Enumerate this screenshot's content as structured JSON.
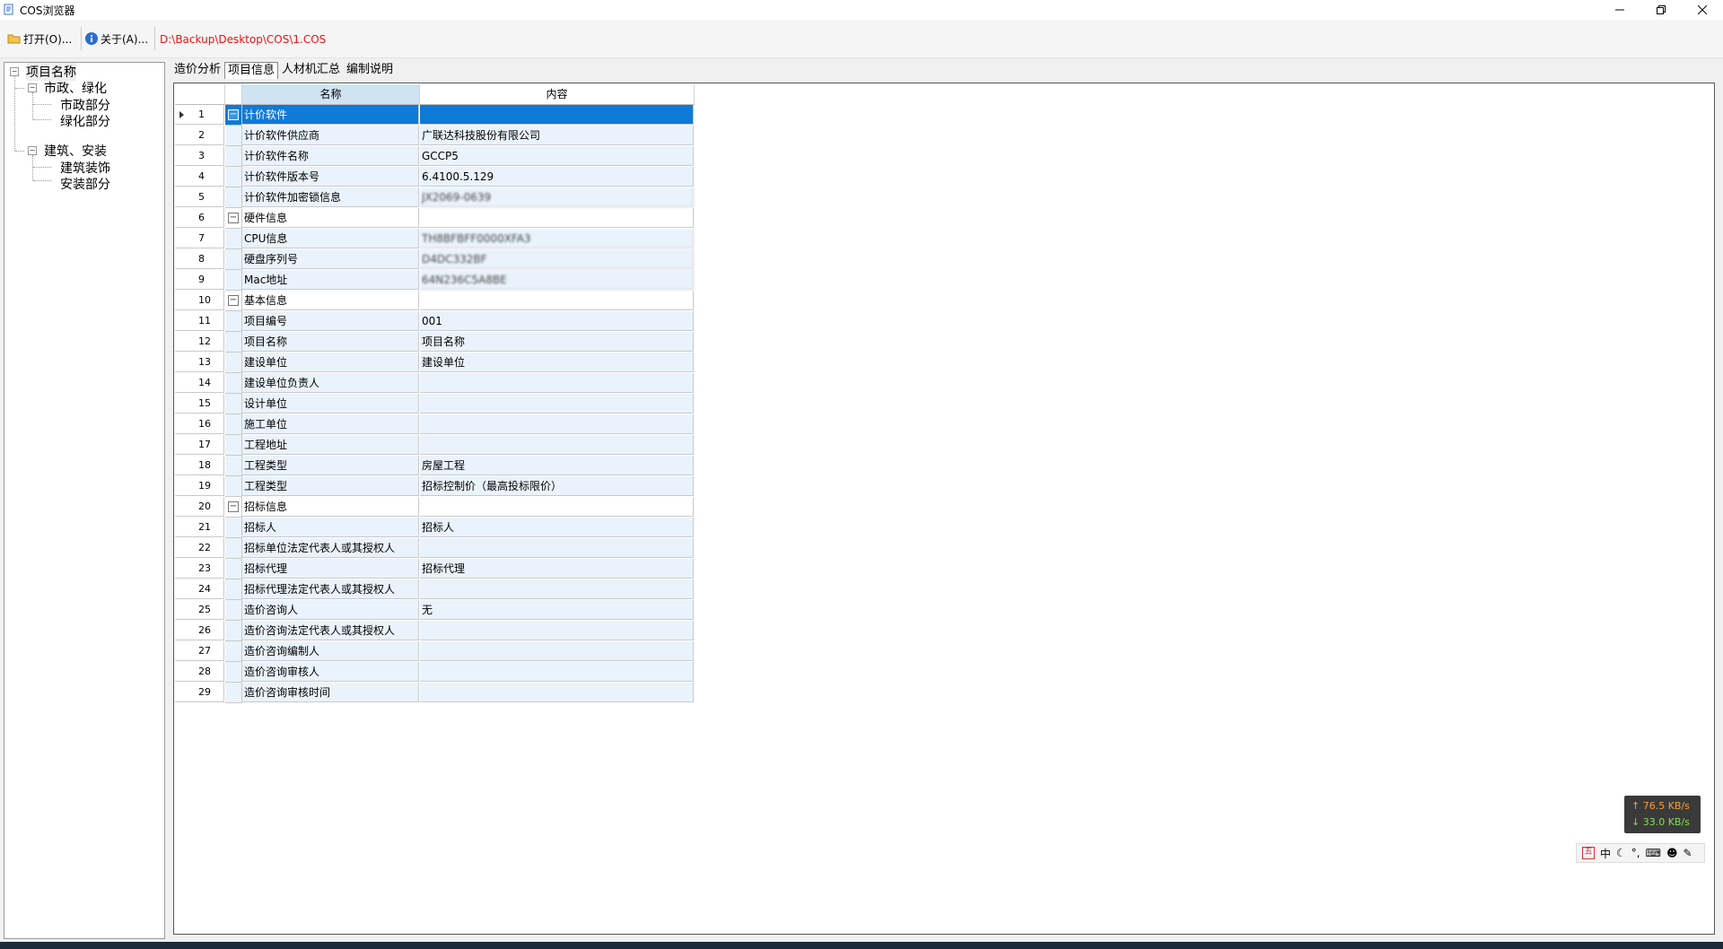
{
  "window": {
    "title": "COS浏览器"
  },
  "toolbar": {
    "open_label": "打开(O)...",
    "about_label": "关于(A)...",
    "file_path": "D:\\Backup\\Desktop\\COS\\1.COS"
  },
  "tree": {
    "root": "项目名称",
    "group1": "市政、绿化",
    "g1_child1": "市政部分",
    "g1_child2": "绿化部分",
    "group2": "建筑、安装",
    "g2_child1": "建筑装饰",
    "g2_child2": "安装部分"
  },
  "tabs": [
    "造价分析",
    "项目信息",
    "人材机汇总",
    "编制说明"
  ],
  "grid": {
    "col_name": "名称",
    "col_content": "内容",
    "rows": [
      {
        "no": "1",
        "name": "计价软件",
        "value": "",
        "group": true
      },
      {
        "no": "2",
        "name": "计价软件供应商",
        "value": "广联达科技股份有限公司"
      },
      {
        "no": "3",
        "name": "计价软件名称",
        "value": "GCCP5"
      },
      {
        "no": "4",
        "name": "计价软件版本号",
        "value": "6.4100.5.129"
      },
      {
        "no": "5",
        "name": "计价软件加密锁信息",
        "value": "JX2069-0639",
        "blurred": true
      },
      {
        "no": "6",
        "name": "硬件信息",
        "value": "",
        "group": true
      },
      {
        "no": "7",
        "name": "CPU信息",
        "value": "TH8BFBFF0000XFA3",
        "blurred": true
      },
      {
        "no": "8",
        "name": "硬盘序列号",
        "value": "D4DC332BF",
        "blurred": true
      },
      {
        "no": "9",
        "name": "Mac地址",
        "value": "64N236C5A8BE",
        "blurred": true
      },
      {
        "no": "10",
        "name": "基本信息",
        "value": "",
        "group": true
      },
      {
        "no": "11",
        "name": "项目编号",
        "value": "001"
      },
      {
        "no": "12",
        "name": "项目名称",
        "value": "项目名称"
      },
      {
        "no": "13",
        "name": "建设单位",
        "value": "建设单位"
      },
      {
        "no": "14",
        "name": "建设单位负责人",
        "value": ""
      },
      {
        "no": "15",
        "name": "设计单位",
        "value": ""
      },
      {
        "no": "16",
        "name": "施工单位",
        "value": ""
      },
      {
        "no": "17",
        "name": "工程地址",
        "value": ""
      },
      {
        "no": "18",
        "name": "工程类型",
        "value": "房屋工程"
      },
      {
        "no": "19",
        "name": "工程类型",
        "value": "招标控制价（最高投标限价）"
      },
      {
        "no": "20",
        "name": "招标信息",
        "value": "",
        "group": true
      },
      {
        "no": "21",
        "name": "招标人",
        "value": "招标人"
      },
      {
        "no": "22",
        "name": "招标单位法定代表人或其授权人",
        "value": ""
      },
      {
        "no": "23",
        "name": "招标代理",
        "value": "招标代理"
      },
      {
        "no": "24",
        "name": "招标代理法定代表人或其授权人",
        "value": ""
      },
      {
        "no": "25",
        "name": "造价咨询人",
        "value": "无"
      },
      {
        "no": "26",
        "name": "造价咨询法定代表人或其授权人",
        "value": ""
      },
      {
        "no": "27",
        "name": "造价咨询编制人",
        "value": ""
      },
      {
        "no": "28",
        "name": "造价咨询审核人",
        "value": ""
      },
      {
        "no": "29",
        "name": "造价咨询审核时间",
        "value": ""
      }
    ]
  },
  "netmon": {
    "up": "↑ 76.5 KB/s",
    "down": "↓ 33.0 KB/s"
  },
  "ime": {
    "mode": "中",
    "punct": "°,"
  },
  "colors": {
    "selection": "#0f7ad8",
    "path_text": "#ee1111",
    "child_row_bg": "#eaf3fb"
  }
}
